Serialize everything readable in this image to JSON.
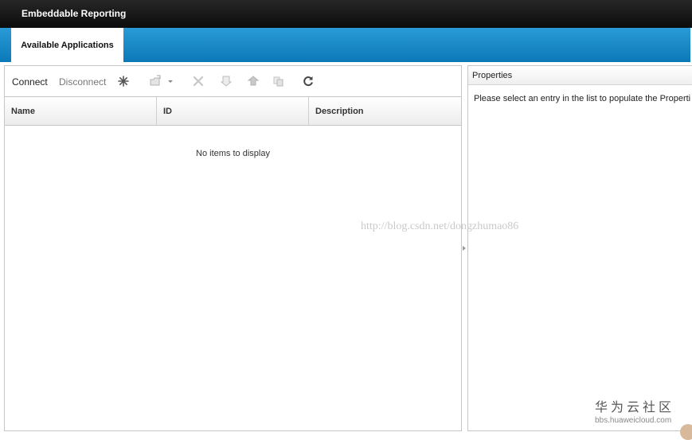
{
  "app": {
    "title": "Embeddable Reporting"
  },
  "tabs": [
    {
      "label": "Available Applications",
      "active": true
    }
  ],
  "toolbar": {
    "connect_label": "Connect",
    "disconnect_label": "Disconnect",
    "icons": [
      "new-icon",
      "import-icon",
      "dropdown-arrow-icon",
      "delete-icon",
      "download-icon",
      "upload-icon",
      "copy-icon",
      "refresh-icon"
    ]
  },
  "grid": {
    "columns": [
      "Name",
      "ID",
      "Description"
    ],
    "rows": [],
    "empty_text": "No items to display"
  },
  "properties": {
    "title": "Properties",
    "message": "Please select an entry in the list to populate the Properti"
  },
  "watermark": "http://blog.csdn.net/dongzhumao86",
  "footer_logo": {
    "title": "华为云社区",
    "url": "bbs.huaweicloud.com"
  },
  "colors": {
    "top_bar": "#111111",
    "tab_strip": "#0b79b8",
    "panel_border": "#c6c6c6"
  }
}
